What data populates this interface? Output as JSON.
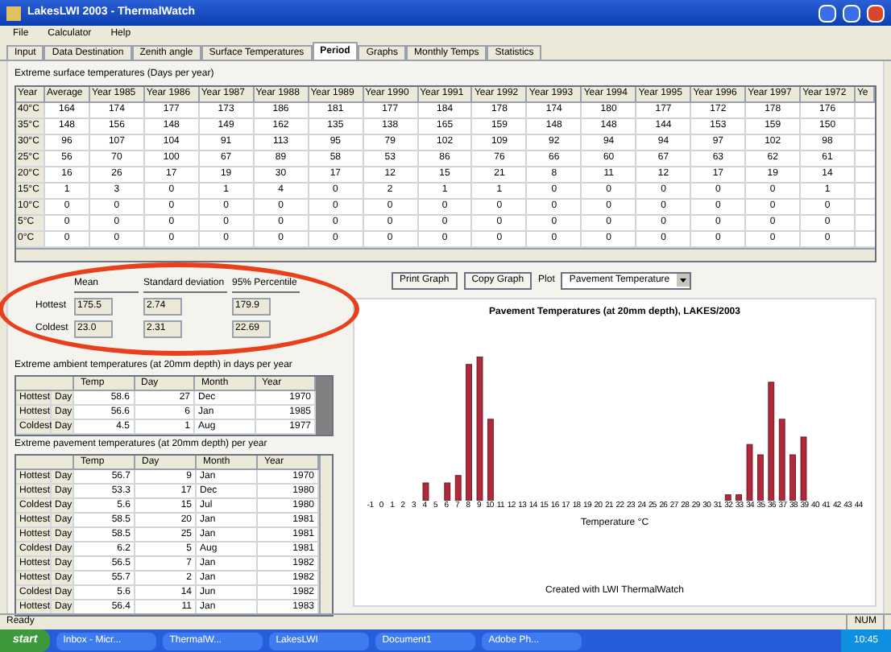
{
  "window": {
    "title": "LakesLWI 2003 - ThermalWatch"
  },
  "menu": [
    "File",
    "Calculator",
    "Help"
  ],
  "tabs": [
    {
      "label": "Input",
      "selected": false
    },
    {
      "label": "Data Destination",
      "selected": false
    },
    {
      "label": "Zenith angle",
      "selected": false
    },
    {
      "label": "Surface Temperatures",
      "selected": false
    },
    {
      "label": "Period",
      "selected": true
    },
    {
      "label": "Graphs",
      "selected": false
    },
    {
      "label": "Monthly Temps",
      "selected": false
    },
    {
      "label": "Statistics",
      "selected": false
    }
  ],
  "surface_table": {
    "caption": "Extreme surface temperatures (Days per year)",
    "columns": [
      "Year",
      "Average",
      "Year 1985",
      "Year 1986",
      "Year 1987",
      "Year 1988",
      "Year 1989",
      "Year 1990",
      "Year 1991",
      "Year 1992",
      "Year 1993",
      "Year 1994",
      "Year 1995",
      "Year 1996",
      "Year 1997",
      "Year 1972",
      "Ye"
    ],
    "rows": [
      [
        "40°C",
        "164",
        "174",
        "177",
        "173",
        "186",
        "181",
        "177",
        "184",
        "178",
        "174",
        "180",
        "177",
        "172",
        "178",
        "176"
      ],
      [
        "35°C",
        "148",
        "156",
        "148",
        "149",
        "162",
        "135",
        "138",
        "165",
        "159",
        "148",
        "148",
        "144",
        "153",
        "159",
        "150"
      ],
      [
        "30°C",
        "96",
        "107",
        "104",
        "91",
        "113",
        "95",
        "79",
        "102",
        "109",
        "92",
        "94",
        "94",
        "97",
        "102",
        "98"
      ],
      [
        "25°C",
        "56",
        "70",
        "100",
        "67",
        "89",
        "58",
        "53",
        "86",
        "76",
        "66",
        "60",
        "67",
        "63",
        "62",
        "61"
      ],
      [
        "20°C",
        "16",
        "26",
        "17",
        "19",
        "30",
        "17",
        "12",
        "15",
        "21",
        "8",
        "11",
        "12",
        "17",
        "19",
        "14"
      ],
      [
        "15°C",
        "1",
        "3",
        "0",
        "1",
        "4",
        "0",
        "2",
        "1",
        "1",
        "0",
        "0",
        "0",
        "0",
        "0",
        "1"
      ],
      [
        "10°C",
        "0",
        "0",
        "0",
        "0",
        "0",
        "0",
        "0",
        "0",
        "0",
        "0",
        "0",
        "0",
        "0",
        "0",
        "0"
      ],
      [
        "5°C",
        "0",
        "0",
        "0",
        "0",
        "0",
        "0",
        "0",
        "0",
        "0",
        "0",
        "0",
        "0",
        "0",
        "0",
        "0"
      ],
      [
        "0°C",
        "0",
        "0",
        "0",
        "0",
        "0",
        "0",
        "0",
        "0",
        "0",
        "0",
        "0",
        "0",
        "0",
        "0",
        "0"
      ]
    ]
  },
  "stats": {
    "columns": [
      "Mean",
      "Standard deviation",
      "95% Percentile"
    ],
    "rows": [
      {
        "label": "Hottest",
        "values": [
          "175.5",
          "2.74",
          "179.9"
        ]
      },
      {
        "label": "Coldest",
        "values": [
          "23.0",
          "2.31",
          "22.69"
        ]
      }
    ]
  },
  "ambient_table": {
    "caption": "Extreme ambient temperatures (at 20mm depth) in days per year",
    "columns": [
      "Temp",
      "Day",
      "Month",
      "Year"
    ],
    "rows": [
      {
        "label": "Hottest",
        "unit": "Day",
        "cells": [
          "58.6",
          "27",
          "Dec",
          "1970"
        ]
      },
      {
        "label": "Hottest",
        "unit": "Day",
        "cells": [
          "56.6",
          "6",
          "Jan",
          "1985"
        ]
      },
      {
        "label": "Coldest",
        "unit": "Day",
        "cells": [
          "4.5",
          "1",
          "Aug",
          "1977"
        ]
      }
    ]
  },
  "pavement_table": {
    "caption": "Extreme pavement temperatures (at 20mm depth) per year",
    "columns": [
      "Temp",
      "Day",
      "Month",
      "Year"
    ],
    "rows": [
      {
        "label": "Hottest",
        "unit": "Day",
        "cells": [
          "56.7",
          "9",
          "Jan",
          "1970"
        ]
      },
      {
        "label": "Hottest",
        "unit": "Day",
        "cells": [
          "53.3",
          "17",
          "Dec",
          "1980"
        ]
      },
      {
        "label": "Coldest",
        "unit": "Day",
        "cells": [
          "5.6",
          "15",
          "Jul",
          "1980"
        ]
      },
      {
        "label": "Hottest",
        "unit": "Day",
        "cells": [
          "58.5",
          "20",
          "Jan",
          "1981"
        ]
      },
      {
        "label": "Hottest",
        "unit": "Day",
        "cells": [
          "58.5",
          "25",
          "Jan",
          "1981"
        ]
      },
      {
        "label": "Coldest",
        "unit": "Day",
        "cells": [
          "6.2",
          "5",
          "Aug",
          "1981"
        ]
      },
      {
        "label": "Hottest",
        "unit": "Day",
        "cells": [
          "56.5",
          "7",
          "Jan",
          "1982"
        ]
      },
      {
        "label": "Hottest",
        "unit": "Day",
        "cells": [
          "55.7",
          "2",
          "Jan",
          "1982"
        ]
      },
      {
        "label": "Coldest",
        "unit": "Day",
        "cells": [
          "5.6",
          "14",
          "Jun",
          "1982"
        ]
      },
      {
        "label": "Hottest",
        "unit": "Day",
        "cells": [
          "56.4",
          "11",
          "Jan",
          "1983"
        ]
      }
    ]
  },
  "graph_controls": {
    "print": "Print Graph",
    "copy": "Copy Graph",
    "plot_label": "Plot",
    "plot_value": "Pavement Temperature"
  },
  "graph": {
    "title": "Pavement Temperatures (at 20mm depth), LAKES/2003",
    "xlabel": "Temperature °C",
    "footer": "Created with LWI ThermalWatch",
    "x_labels": [
      "-1",
      "0",
      "1",
      "2",
      "3",
      "4",
      "5",
      "6",
      "7",
      "8",
      "9",
      "10",
      "11",
      "12",
      "13",
      "14",
      "15",
      "16",
      "17",
      "18",
      "19",
      "20",
      "21",
      "22",
      "23",
      "24",
      "25",
      "26",
      "27",
      "28",
      "29",
      "30",
      "31",
      "32",
      "33",
      "34",
      "35",
      "36",
      "37",
      "38",
      "39",
      "40",
      "41",
      "42",
      "43",
      "44"
    ]
  },
  "status_bar": {
    "left": "Ready",
    "right": "NUM"
  },
  "taskbar": {
    "start": "start",
    "items": [
      "Inbox - Micr...",
      "ThermalW...",
      "LakesLWI",
      "Document1",
      "Adobe Ph..."
    ],
    "clock": "10:45"
  }
}
